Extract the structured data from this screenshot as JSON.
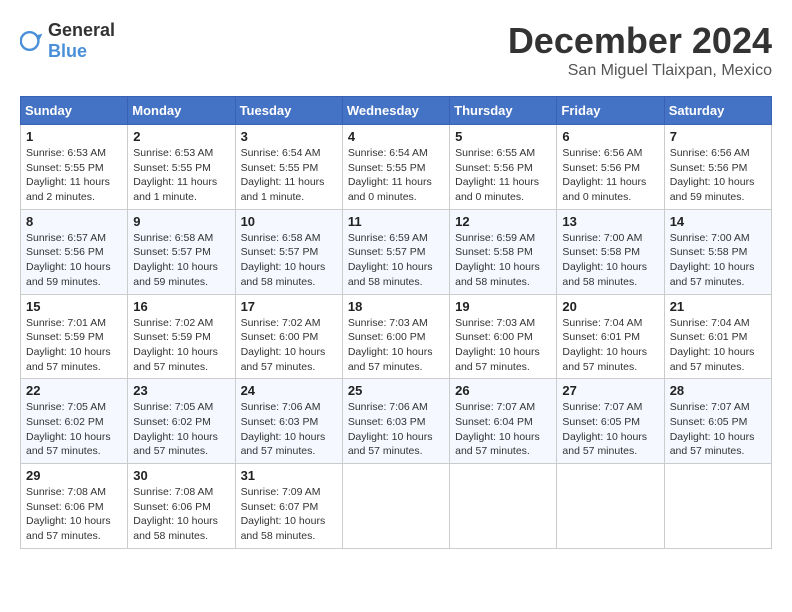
{
  "logo": {
    "general": "General",
    "blue": "Blue"
  },
  "title": "December 2024",
  "location": "San Miguel Tlaixpan, Mexico",
  "days_of_week": [
    "Sunday",
    "Monday",
    "Tuesday",
    "Wednesday",
    "Thursday",
    "Friday",
    "Saturday"
  ],
  "weeks": [
    [
      {
        "day": "1",
        "info": "Sunrise: 6:53 AM\nSunset: 5:55 PM\nDaylight: 11 hours and 2 minutes."
      },
      {
        "day": "2",
        "info": "Sunrise: 6:53 AM\nSunset: 5:55 PM\nDaylight: 11 hours and 1 minute."
      },
      {
        "day": "3",
        "info": "Sunrise: 6:54 AM\nSunset: 5:55 PM\nDaylight: 11 hours and 1 minute."
      },
      {
        "day": "4",
        "info": "Sunrise: 6:54 AM\nSunset: 5:55 PM\nDaylight: 11 hours and 0 minutes."
      },
      {
        "day": "5",
        "info": "Sunrise: 6:55 AM\nSunset: 5:56 PM\nDaylight: 11 hours and 0 minutes."
      },
      {
        "day": "6",
        "info": "Sunrise: 6:56 AM\nSunset: 5:56 PM\nDaylight: 11 hours and 0 minutes."
      },
      {
        "day": "7",
        "info": "Sunrise: 6:56 AM\nSunset: 5:56 PM\nDaylight: 10 hours and 59 minutes."
      }
    ],
    [
      {
        "day": "8",
        "info": "Sunrise: 6:57 AM\nSunset: 5:56 PM\nDaylight: 10 hours and 59 minutes."
      },
      {
        "day": "9",
        "info": "Sunrise: 6:58 AM\nSunset: 5:57 PM\nDaylight: 10 hours and 59 minutes."
      },
      {
        "day": "10",
        "info": "Sunrise: 6:58 AM\nSunset: 5:57 PM\nDaylight: 10 hours and 58 minutes."
      },
      {
        "day": "11",
        "info": "Sunrise: 6:59 AM\nSunset: 5:57 PM\nDaylight: 10 hours and 58 minutes."
      },
      {
        "day": "12",
        "info": "Sunrise: 6:59 AM\nSunset: 5:58 PM\nDaylight: 10 hours and 58 minutes."
      },
      {
        "day": "13",
        "info": "Sunrise: 7:00 AM\nSunset: 5:58 PM\nDaylight: 10 hours and 58 minutes."
      },
      {
        "day": "14",
        "info": "Sunrise: 7:00 AM\nSunset: 5:58 PM\nDaylight: 10 hours and 57 minutes."
      }
    ],
    [
      {
        "day": "15",
        "info": "Sunrise: 7:01 AM\nSunset: 5:59 PM\nDaylight: 10 hours and 57 minutes."
      },
      {
        "day": "16",
        "info": "Sunrise: 7:02 AM\nSunset: 5:59 PM\nDaylight: 10 hours and 57 minutes."
      },
      {
        "day": "17",
        "info": "Sunrise: 7:02 AM\nSunset: 6:00 PM\nDaylight: 10 hours and 57 minutes."
      },
      {
        "day": "18",
        "info": "Sunrise: 7:03 AM\nSunset: 6:00 PM\nDaylight: 10 hours and 57 minutes."
      },
      {
        "day": "19",
        "info": "Sunrise: 7:03 AM\nSunset: 6:00 PM\nDaylight: 10 hours and 57 minutes."
      },
      {
        "day": "20",
        "info": "Sunrise: 7:04 AM\nSunset: 6:01 PM\nDaylight: 10 hours and 57 minutes."
      },
      {
        "day": "21",
        "info": "Sunrise: 7:04 AM\nSunset: 6:01 PM\nDaylight: 10 hours and 57 minutes."
      }
    ],
    [
      {
        "day": "22",
        "info": "Sunrise: 7:05 AM\nSunset: 6:02 PM\nDaylight: 10 hours and 57 minutes."
      },
      {
        "day": "23",
        "info": "Sunrise: 7:05 AM\nSunset: 6:02 PM\nDaylight: 10 hours and 57 minutes."
      },
      {
        "day": "24",
        "info": "Sunrise: 7:06 AM\nSunset: 6:03 PM\nDaylight: 10 hours and 57 minutes."
      },
      {
        "day": "25",
        "info": "Sunrise: 7:06 AM\nSunset: 6:03 PM\nDaylight: 10 hours and 57 minutes."
      },
      {
        "day": "26",
        "info": "Sunrise: 7:07 AM\nSunset: 6:04 PM\nDaylight: 10 hours and 57 minutes."
      },
      {
        "day": "27",
        "info": "Sunrise: 7:07 AM\nSunset: 6:05 PM\nDaylight: 10 hours and 57 minutes."
      },
      {
        "day": "28",
        "info": "Sunrise: 7:07 AM\nSunset: 6:05 PM\nDaylight: 10 hours and 57 minutes."
      }
    ],
    [
      {
        "day": "29",
        "info": "Sunrise: 7:08 AM\nSunset: 6:06 PM\nDaylight: 10 hours and 57 minutes."
      },
      {
        "day": "30",
        "info": "Sunrise: 7:08 AM\nSunset: 6:06 PM\nDaylight: 10 hours and 58 minutes."
      },
      {
        "day": "31",
        "info": "Sunrise: 7:09 AM\nSunset: 6:07 PM\nDaylight: 10 hours and 58 minutes."
      },
      null,
      null,
      null,
      null
    ]
  ]
}
